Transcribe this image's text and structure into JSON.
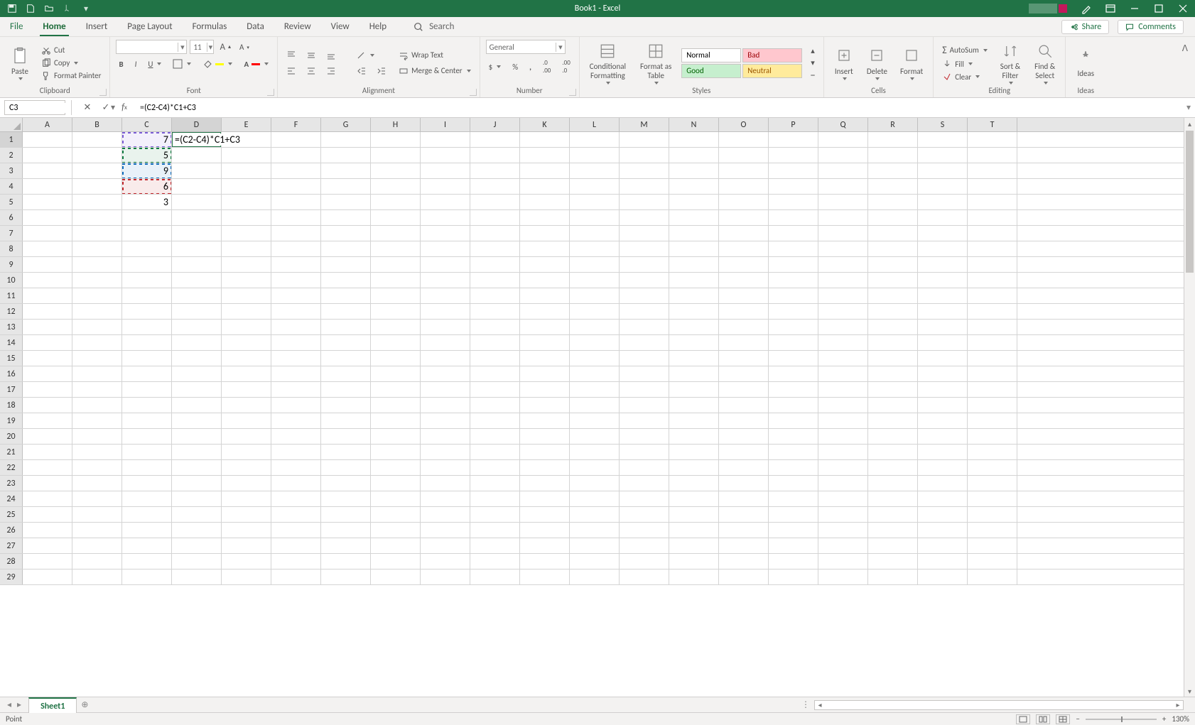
{
  "app": {
    "title": "Book1 - Excel"
  },
  "tabs": {
    "file": "File",
    "items": [
      "Home",
      "Insert",
      "Page Layout",
      "Formulas",
      "Data",
      "Review",
      "View",
      "Help"
    ],
    "active": "Home",
    "search_placeholder": "Search",
    "share": "Share",
    "comments": "Comments"
  },
  "ribbon": {
    "clipboard": {
      "label": "Clipboard",
      "paste": "Paste",
      "cut": "Cut",
      "copy": "Copy",
      "format_painter": "Format Painter"
    },
    "font": {
      "label": "Font",
      "name": "",
      "size": "11"
    },
    "alignment": {
      "label": "Alignment",
      "wrap": "Wrap Text",
      "merge": "Merge & Center"
    },
    "number": {
      "label": "Number",
      "format": "General"
    },
    "styles": {
      "label": "Styles",
      "conditional": "Conditional Formatting",
      "table": "Format as Table",
      "normal": "Normal",
      "bad": "Bad",
      "good": "Good",
      "neutral": "Neutral"
    },
    "cells": {
      "label": "Cells",
      "insert": "Insert",
      "delete": "Delete",
      "format": "Format"
    },
    "editing": {
      "label": "Editing",
      "autosum": "AutoSum",
      "fill": "Fill",
      "clear": "Clear",
      "sort": "Sort & Filter",
      "find": "Find & Select"
    },
    "ideas": {
      "label": "Ideas",
      "ideas": "Ideas"
    }
  },
  "formula_bar": {
    "name_box": "C3",
    "formula": "=(C2-C4)*C1+C3"
  },
  "grid": {
    "columns": [
      "A",
      "B",
      "C",
      "D",
      "E",
      "F",
      "G",
      "H",
      "I",
      "J",
      "K",
      "L",
      "M",
      "N",
      "O",
      "P",
      "Q",
      "R",
      "S",
      "T"
    ],
    "active_col": "D",
    "active_row": 1,
    "rows": 29,
    "cells": {
      "C1": "7",
      "C2": "5",
      "C3": "9",
      "C4": "6",
      "C5": "3",
      "D1": "=(C2-C4)*C1+C3"
    },
    "editing_cell": "D1",
    "ref_highlights": [
      {
        "cell": "C1",
        "color": "#7b5cd6"
      },
      {
        "cell": "C2",
        "color": "#107c41"
      },
      {
        "cell": "C3",
        "color": "#0f6cbd"
      },
      {
        "cell": "C4",
        "color": "#c1272d"
      }
    ]
  },
  "sheet": {
    "name": "Sheet1"
  },
  "status": {
    "mode": "Point",
    "zoom": "130%"
  }
}
